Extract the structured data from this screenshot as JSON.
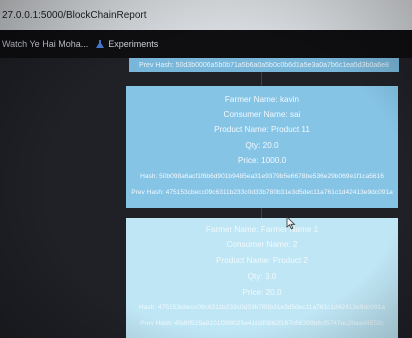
{
  "browser": {
    "url": "27.0.0.1:5000/BlockChainReport"
  },
  "bookmarks": [
    {
      "label": "Watch Ye Hai Moha..."
    },
    {
      "label": "Experiments"
    }
  ],
  "report": {
    "top_strip": "Prev Hash: 50d3b0006a5b0b71a5b6a0a5b0c0b6d1a5e3a0a7b6c1ea5d3b0a6e8",
    "records": [
      {
        "farmer": "Farmer Name: kavin",
        "consumer": "Consumer Name: sai",
        "product": "Product Name: Product 11",
        "qty": "Qty: 20.0",
        "price": "Price: 1000.0",
        "hash": "Hash: 50b098a6acf1f6b6d901b9485ea31e9379b5e6678be536e29b069e1f1ca5616",
        "prev_hash": "Prev Hash: 475153cbecc09c6311b233c0d33b780b31e3d5dec11a761c1d42413e9dc091a"
      },
      {
        "farmer": "Farmer Name: Farmer Name 1",
        "consumer": "Consumer Name: 2",
        "product": "Product Name: Product 2",
        "qty": "Qty: 3.0",
        "price": "Price: 20.0",
        "hash": "Hash: 475153cbecc09c6311b233c0d33b780b31e3d5dec11a761c1d42413e9dc091a",
        "prev_hash": "Prev Hash: 45d0f525a8101f398025e41b3f0862f167c66399b8cf5747ec2baad4553c"
      }
    ]
  }
}
